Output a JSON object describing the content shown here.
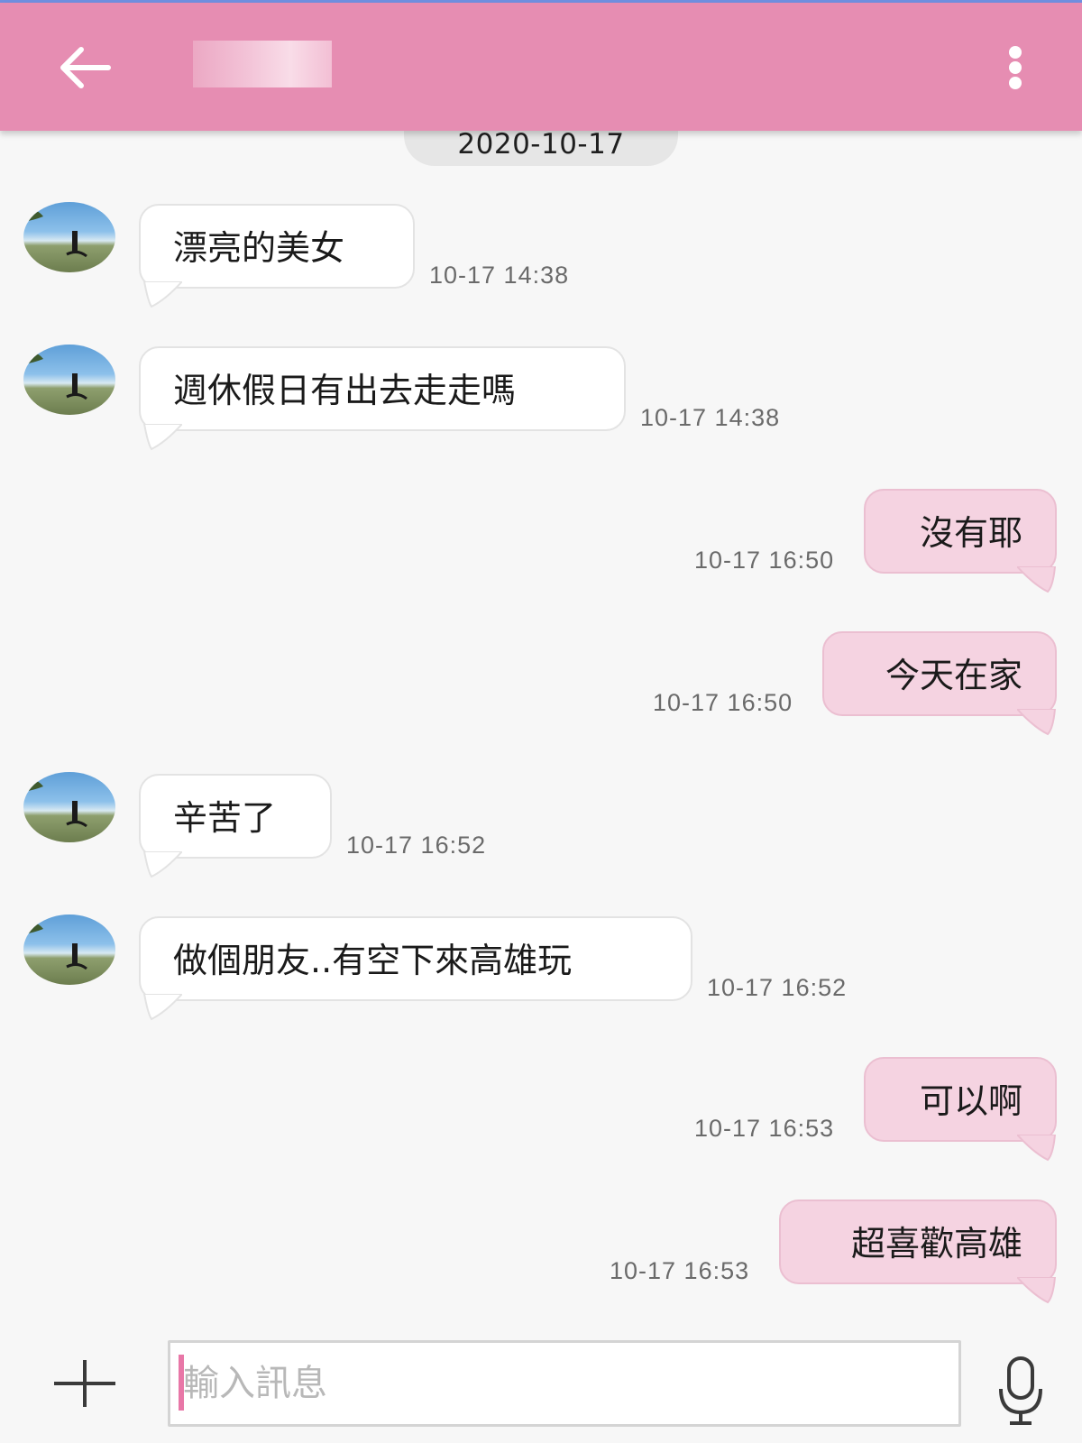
{
  "header": {
    "back_icon": "back-arrow-icon",
    "contact_name": "",
    "more_icon": "more-vertical-icon",
    "bar_color": "#e68db2"
  },
  "date_divider": "2020-10-17",
  "messages": [
    {
      "direction": "incoming",
      "text": "漂亮的美女",
      "time": "10-17 14:38"
    },
    {
      "direction": "incoming",
      "text": "週休假日有出去走走嗎",
      "time": "10-17 14:38"
    },
    {
      "direction": "outgoing",
      "text": "沒有耶",
      "time": "10-17 16:50"
    },
    {
      "direction": "outgoing",
      "text": "今天在家",
      "time": "10-17 16:50"
    },
    {
      "direction": "incoming",
      "text": "辛苦了",
      "time": "10-17 16:52"
    },
    {
      "direction": "incoming",
      "text": "做個朋友..有空下來高雄玩",
      "time": "10-17 16:52"
    },
    {
      "direction": "outgoing",
      "text": "可以啊",
      "time": "10-17 16:53"
    },
    {
      "direction": "outgoing",
      "text": "超喜歡高雄",
      "time": "10-17 16:53"
    }
  ],
  "composer": {
    "add_icon": "plus-icon",
    "placeholder": "輸入訊息",
    "mic_icon": "microphone-icon"
  },
  "colors": {
    "incoming_bubble": "#ffffff",
    "outgoing_bubble": "#f5d3e1",
    "caret": "#e877a7"
  }
}
